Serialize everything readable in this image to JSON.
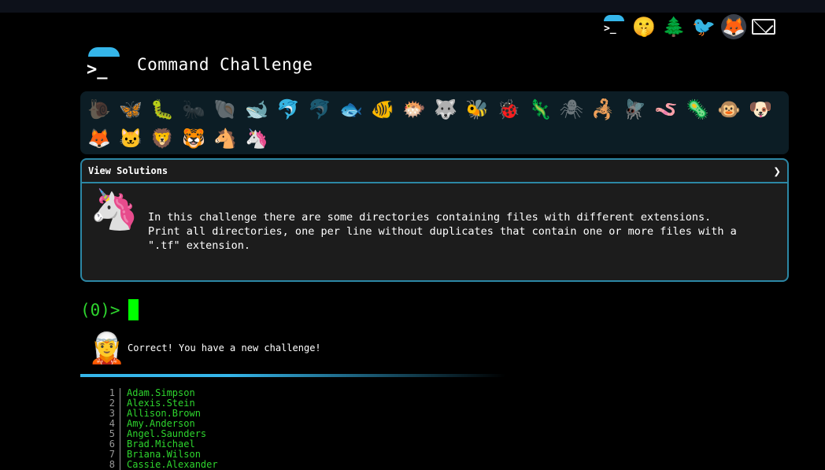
{
  "header": {
    "title": "Command Challenge",
    "logo_glyph": ">_",
    "icons": [
      {
        "name": "terminal-logo-icon",
        "glyph": ">_"
      },
      {
        "name": "shushing-face-icon",
        "glyph": "🤫"
      },
      {
        "name": "tree-icon",
        "glyph": "🌲"
      },
      {
        "name": "twitter-icon",
        "glyph": "🐦"
      },
      {
        "name": "gitlab-icon",
        "glyph": "🦊"
      },
      {
        "name": "mail-icon",
        "glyph": ""
      }
    ]
  },
  "animals": [
    {
      "name": "snail",
      "glyph": "🐌",
      "dim": true
    },
    {
      "name": "butterfly",
      "glyph": "🦋",
      "dim": false
    },
    {
      "name": "caterpillar",
      "glyph": "🐛",
      "dim": false
    },
    {
      "name": "ant",
      "glyph": "🐜",
      "dim": true
    },
    {
      "name": "shell",
      "glyph": "🐚",
      "dim": true
    },
    {
      "name": "whale",
      "glyph": "🐋",
      "dim": false
    },
    {
      "name": "dolphin",
      "glyph": "🐬",
      "dim": false
    },
    {
      "name": "dolphin-grey",
      "glyph": "🐬",
      "dim": true
    },
    {
      "name": "fish",
      "glyph": "🐟",
      "dim": false
    },
    {
      "name": "tropical-fish",
      "glyph": "🐠",
      "dim": false
    },
    {
      "name": "blowfish",
      "glyph": "🐡",
      "dim": false
    },
    {
      "name": "wolf",
      "glyph": "🐺",
      "dim": false
    },
    {
      "name": "bee",
      "glyph": "🐝",
      "dim": false
    },
    {
      "name": "ladybug",
      "glyph": "🐞",
      "dim": false
    },
    {
      "name": "lizard",
      "glyph": "🦎",
      "dim": false
    },
    {
      "name": "spider",
      "glyph": "🕷",
      "dim": true
    },
    {
      "name": "scorpion",
      "glyph": "🦂",
      "dim": false
    },
    {
      "name": "fly",
      "glyph": "🪰",
      "dim": false
    },
    {
      "name": "worm",
      "glyph": "🪱",
      "dim": false
    },
    {
      "name": "bacteria",
      "glyph": "🦠",
      "dim": false
    },
    {
      "name": "monkey",
      "glyph": "🐵",
      "dim": false
    },
    {
      "name": "dog",
      "glyph": "🐶",
      "dim": false
    },
    {
      "name": "fox",
      "glyph": "🦊",
      "dim": false
    },
    {
      "name": "cat",
      "glyph": "🐱",
      "dim": false
    },
    {
      "name": "lion",
      "glyph": "🦁",
      "dim": false
    },
    {
      "name": "tiger",
      "glyph": "🐯",
      "dim": false
    },
    {
      "name": "horse",
      "glyph": "🐴",
      "dim": false
    },
    {
      "name": "unicorn",
      "glyph": "🦄",
      "dim": false
    }
  ],
  "panel": {
    "header_label": "View Solutions",
    "toggle_glyph": "❯",
    "avatar_glyph": "🦄",
    "description_lines": [
      "In this challenge there are some directories containing files with different extensions.",
      "Print all directories, one per line without duplicates that contain one or more files with a",
      "\".tf\" extension."
    ]
  },
  "prompt": {
    "text": "(0)>"
  },
  "result": {
    "avatar_glyph": "🧝",
    "message": "Correct! You have a new challenge!"
  },
  "listing": [
    {
      "num": "1",
      "text": "Adam.Simpson"
    },
    {
      "num": "2",
      "text": "Alexis.Stein"
    },
    {
      "num": "3",
      "text": "Allison.Brown"
    },
    {
      "num": "4",
      "text": "Amy.Anderson"
    },
    {
      "num": "5",
      "text": "Angel.Saunders"
    },
    {
      "num": "6",
      "text": "Brad.Michael"
    },
    {
      "num": "7",
      "text": "Briana.Wilson"
    },
    {
      "num": "8",
      "text": "Cassie.Alexander"
    }
  ],
  "colors": {
    "accent_blue": "#35b6ea",
    "panel_border": "#2c87a5",
    "terminal_green": "#2ed52e",
    "cursor_green": "#00ff00"
  }
}
